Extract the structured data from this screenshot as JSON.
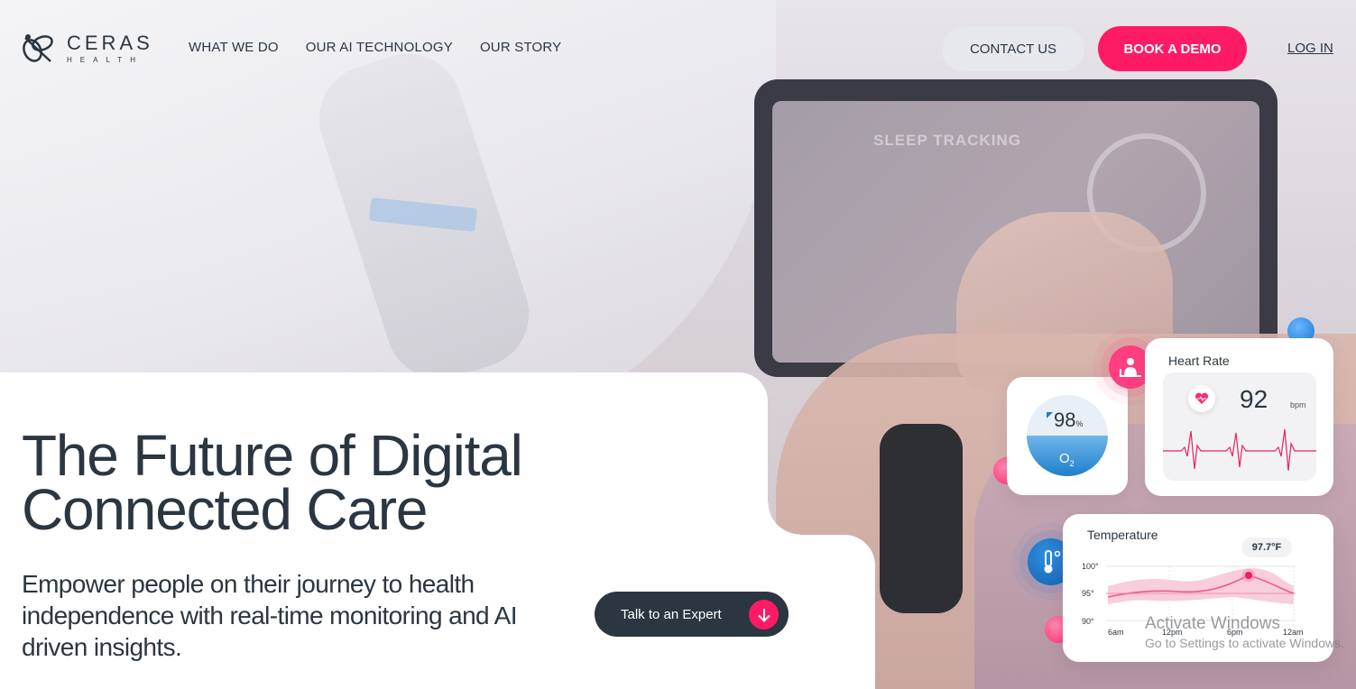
{
  "brand": {
    "name": "CERAS",
    "sub": "HEALTH",
    "accent": "#ff1a66",
    "dark": "#2b3640"
  },
  "nav": {
    "items": [
      "WHAT WE DO",
      "OUR AI TECHNOLOGY",
      "OUR STORY"
    ]
  },
  "header": {
    "contact_label": "CONTACT US",
    "demo_label": "BOOK A DEMO",
    "login_label": "LOG IN"
  },
  "background": {
    "tablet_title": "SLEEP TRACKING"
  },
  "hero": {
    "headline_line1": "The Future of Digital",
    "headline_line2": "Connected Care",
    "subtitle": "Empower people on their journey to health independence with real-time monitoring and AI driven insights.",
    "cta_label": "Talk to an Expert"
  },
  "widgets": {
    "oxygen": {
      "value": "98",
      "unit": "%",
      "label_main": "O",
      "label_sub": "2",
      "fill_fraction": 0.5
    },
    "heart_rate": {
      "title": "Heart Rate",
      "value": "92",
      "unit": "bpm"
    },
    "temperature": {
      "title": "Temperature",
      "badge": "97.7°F",
      "y_ticks": [
        "100°",
        "95°",
        "90°"
      ],
      "x_ticks": [
        "6am",
        "12pm",
        "6pm",
        "12am"
      ]
    }
  },
  "watermark": {
    "title": "Activate Windows",
    "subtitle": "Go to Settings to activate Windows."
  }
}
